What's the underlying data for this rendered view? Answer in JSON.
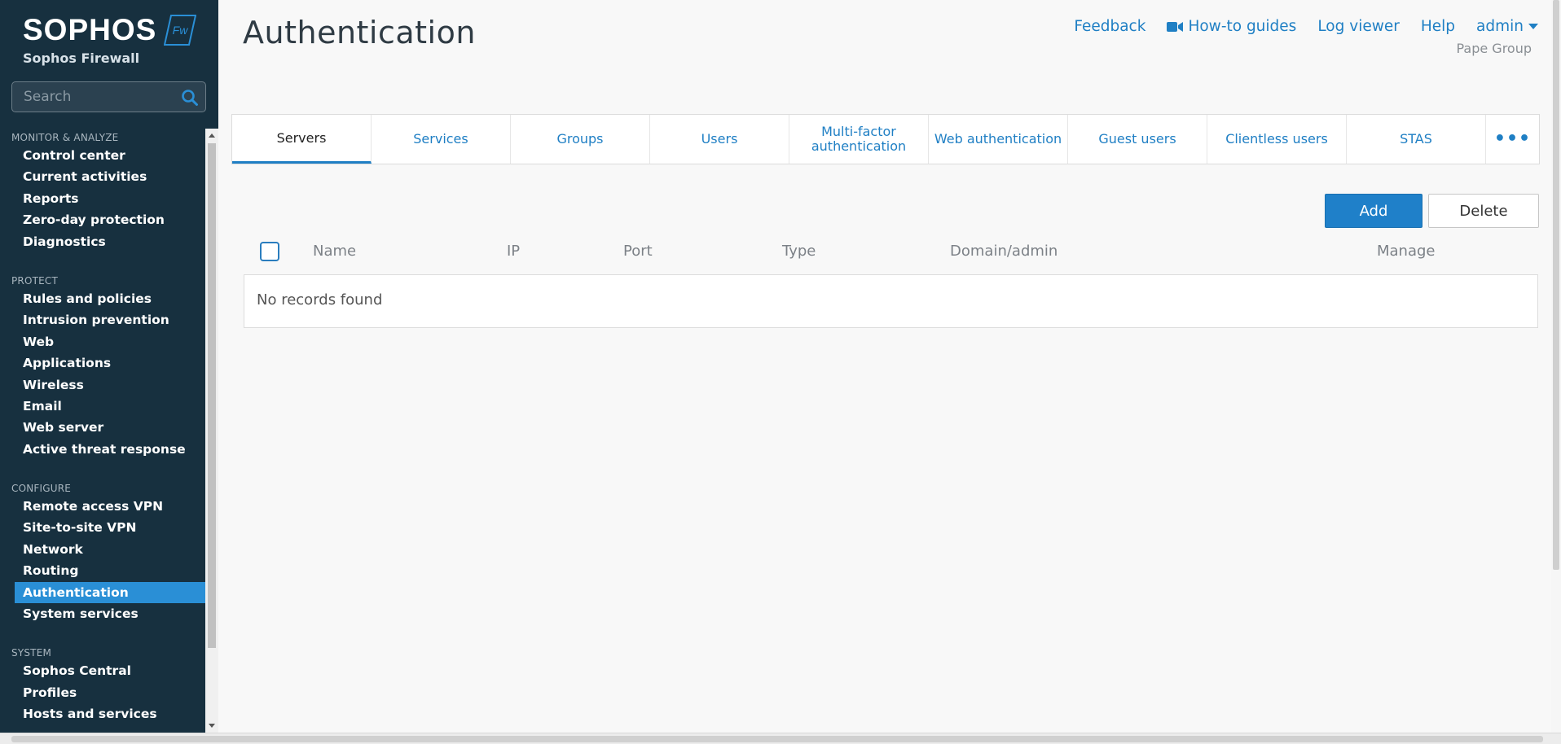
{
  "brand": {
    "logo_text": "SOPHOS",
    "badge_text": "Fw",
    "product": "Sophos Firewall"
  },
  "search": {
    "placeholder": "Search"
  },
  "sidebar": {
    "sections": [
      {
        "title": "MONITOR & ANALYZE",
        "items": [
          "Control center",
          "Current activities",
          "Reports",
          "Zero-day protection",
          "Diagnostics"
        ]
      },
      {
        "title": "PROTECT",
        "items": [
          "Rules and policies",
          "Intrusion prevention",
          "Web",
          "Applications",
          "Wireless",
          "Email",
          "Web server",
          "Active threat response"
        ]
      },
      {
        "title": "CONFIGURE",
        "items": [
          "Remote access VPN",
          "Site-to-site VPN",
          "Network",
          "Routing",
          "Authentication",
          "System services"
        ]
      },
      {
        "title": "SYSTEM",
        "items": [
          "Sophos Central",
          "Profiles",
          "Hosts and services"
        ]
      }
    ],
    "active_item": "Authentication"
  },
  "header": {
    "title": "Authentication",
    "links": {
      "feedback": "Feedback",
      "howto": "How-to guides",
      "logviewer": "Log viewer",
      "help": "Help",
      "user": "admin"
    },
    "org": "Pape Group"
  },
  "tabs": {
    "servers": "Servers",
    "services": "Services",
    "groups": "Groups",
    "users": "Users",
    "mfa_line1": "Multi-factor",
    "mfa_line2": "authentication",
    "webauth": "Web authentication",
    "guest": "Guest users",
    "clientless": "Clientless users",
    "stas": "STAS",
    "more": "•••",
    "active": "Servers"
  },
  "toolbar": {
    "add": "Add",
    "delete": "Delete"
  },
  "table": {
    "columns": {
      "name": "Name",
      "ip": "IP",
      "port": "Port",
      "type": "Type",
      "domain": "Domain/admin",
      "manage": "Manage"
    },
    "empty_message": "No records found"
  },
  "colors": {
    "sidebar_bg": "#17303f",
    "accent": "#1f7fc4",
    "active_item": "#2a8fd6"
  }
}
